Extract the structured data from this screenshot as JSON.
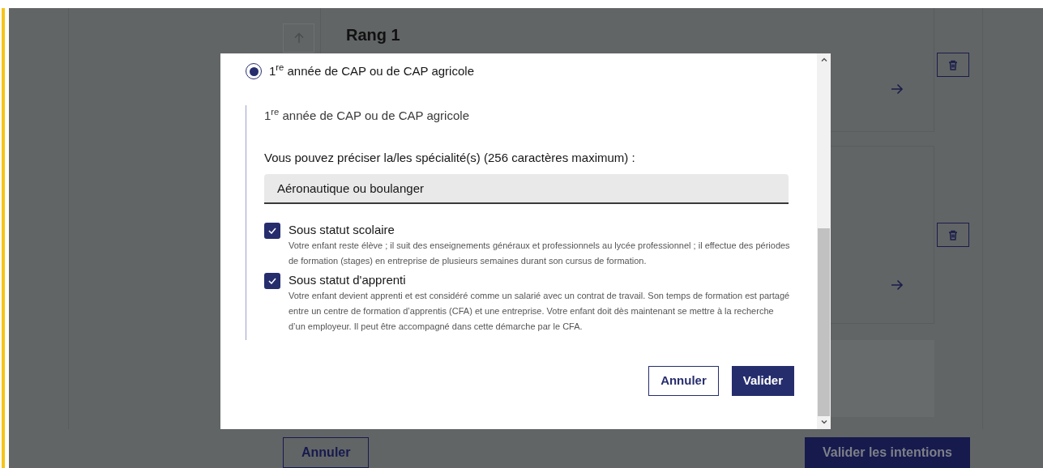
{
  "background_page": {
    "rank_title": "Rang 1",
    "bottom_buttons": [
      {
        "label": "Annuler",
        "kind": "secondary"
      },
      {
        "label": "Valider les intentions",
        "kind": "primary"
      }
    ]
  },
  "dialog": {
    "option": {
      "label": "1$^{re}$ année de CAP ou de CAP agricole",
      "selected": true
    },
    "subtitle": "1$^{re}$ année de CAP ou de CAP agricole",
    "field": {
      "label": "Vous pouvez préciser la/les spécialité(s) (256 caractères maximum) :",
      "value": "Aéronautique ou boulanger"
    },
    "statuses": [
      {
        "label": "Sous statut scolaire",
        "description": "Votre enfant reste élève ; il suit des enseignements généraux et professionnels au lycée professionnel ; il effectue des périodes de formation (stages) en entreprise de plusieurs semaines durant son cursus de formation.",
        "checked": true
      },
      {
        "label": "Sous statut d'apprenti",
        "description": "Votre enfant devient apprenti et est considéré comme un salarié avec un contrat de travail. Son temps de formation est partagé entre un centre de formation d’apprentis (CFA) et une entreprise. Votre enfant doit dès maintenant se mettre à la recherche d’un employeur. Il peut être accompagné dans cette démarche par le CFA.",
        "checked": true
      }
    ],
    "buttons": [
      {
        "label": "Annuler",
        "kind": "secondary"
      },
      {
        "label": "Valider",
        "kind": "primary"
      }
    ]
  }
}
